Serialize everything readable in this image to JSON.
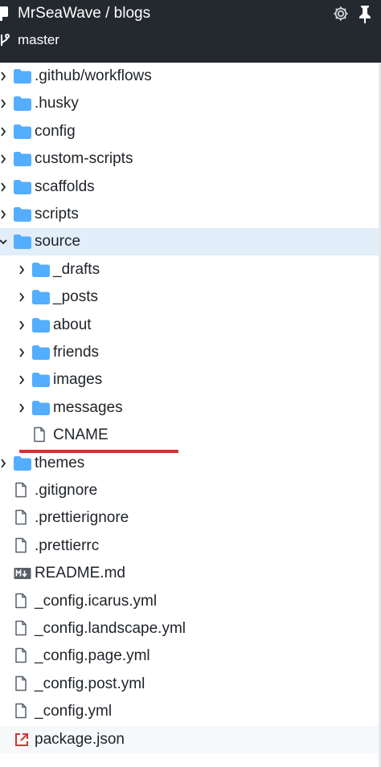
{
  "header": {
    "repo_title": "MrSeaWave / blogs",
    "branch": "master"
  },
  "tree": [
    {
      "label": ".github/workflows",
      "type": "folder",
      "depth": 0,
      "expanded": false
    },
    {
      "label": ".husky",
      "type": "folder",
      "depth": 0,
      "expanded": false
    },
    {
      "label": "config",
      "type": "folder",
      "depth": 0,
      "expanded": false
    },
    {
      "label": "custom-scripts",
      "type": "folder",
      "depth": 0,
      "expanded": false
    },
    {
      "label": "scaffolds",
      "type": "folder",
      "depth": 0,
      "expanded": false
    },
    {
      "label": "scripts",
      "type": "folder",
      "depth": 0,
      "expanded": false
    },
    {
      "label": "source",
      "type": "folder",
      "depth": 0,
      "expanded": true,
      "selected": true
    },
    {
      "label": "_drafts",
      "type": "folder",
      "depth": 1,
      "expanded": false
    },
    {
      "label": "_posts",
      "type": "folder",
      "depth": 1,
      "expanded": false
    },
    {
      "label": "about",
      "type": "folder",
      "depth": 1,
      "expanded": false
    },
    {
      "label": "friends",
      "type": "folder",
      "depth": 1,
      "expanded": false
    },
    {
      "label": "images",
      "type": "folder",
      "depth": 1,
      "expanded": false
    },
    {
      "label": "messages",
      "type": "folder",
      "depth": 1,
      "expanded": false
    },
    {
      "label": "CNAME",
      "type": "file",
      "depth": 1,
      "highlighted": true
    },
    {
      "label": "themes",
      "type": "folder",
      "depth": 0,
      "expanded": false
    },
    {
      "label": ".gitignore",
      "type": "file",
      "depth": 0
    },
    {
      "label": ".prettierignore",
      "type": "file",
      "depth": 0
    },
    {
      "label": ".prettierrc",
      "type": "file",
      "depth": 0
    },
    {
      "label": "README.md",
      "type": "markdown",
      "depth": 0
    },
    {
      "label": "_config.icarus.yml",
      "type": "file",
      "depth": 0
    },
    {
      "label": "_config.landscape.yml",
      "type": "file",
      "depth": 0
    },
    {
      "label": "_config.page.yml",
      "type": "file",
      "depth": 0
    },
    {
      "label": "_config.post.yml",
      "type": "file",
      "depth": 0
    },
    {
      "label": "_config.yml",
      "type": "file",
      "depth": 0
    },
    {
      "label": "package.json",
      "type": "npm",
      "depth": 0
    }
  ],
  "colors": {
    "header_bg": "#24292f",
    "folder": "#54aeff",
    "selected_bg": "#e2eefa",
    "highlight_underline": "#c5382f",
    "npm_icon": "#cb3837"
  },
  "icons": {
    "repo": "repo-icon",
    "branch": "git-branch-icon",
    "settings": "gear-icon",
    "pin": "pin-icon"
  }
}
